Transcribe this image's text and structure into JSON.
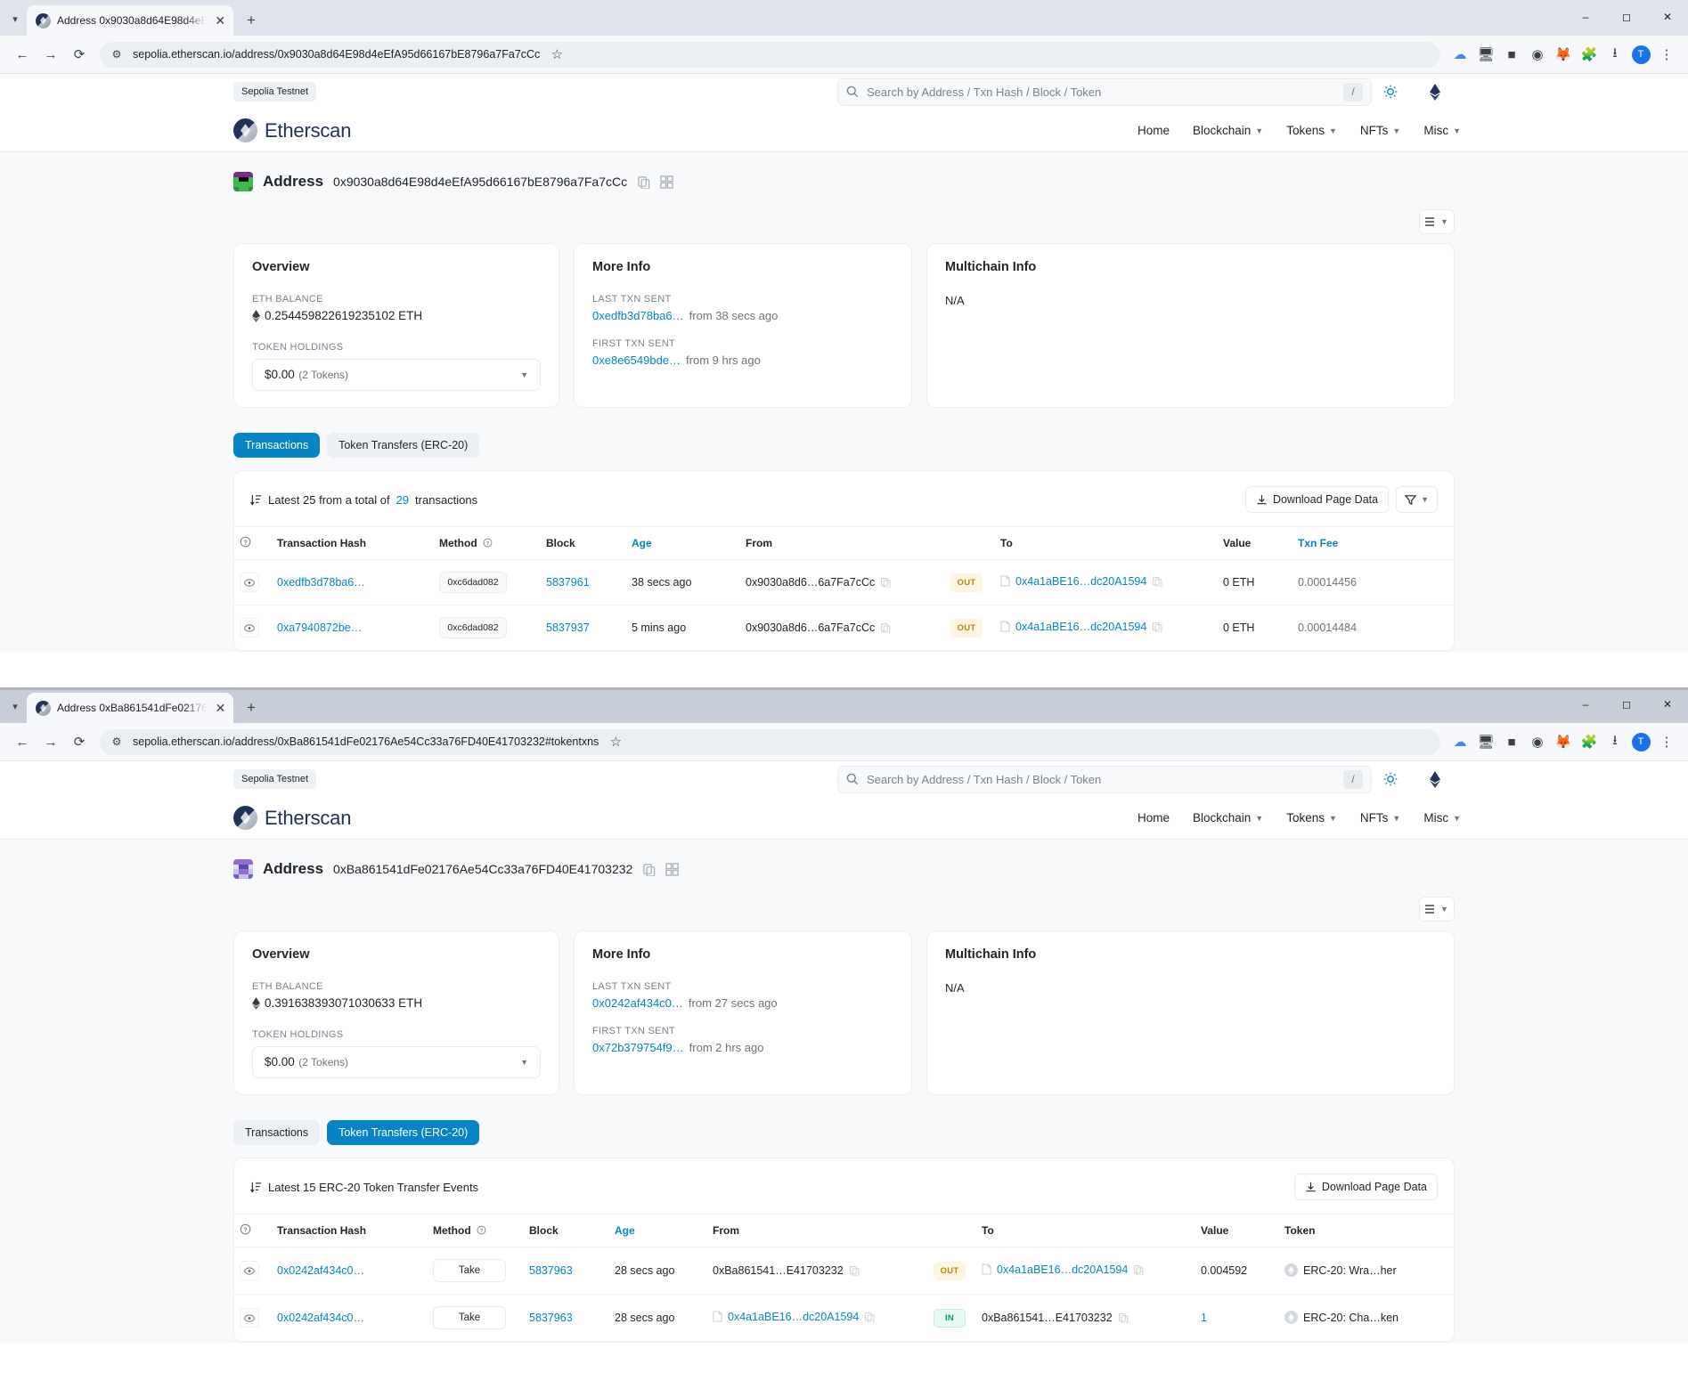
{
  "windows": [
    {
      "tab_title": "Address 0x9030a8d64E98d4eEf",
      "url": "sepolia.etherscan.io/address/0x9030a8d64E98d4eEfA95d66167bE8796a7Fa7cCc",
      "testnet_badge": "Sepolia Testnet",
      "search_placeholder": "Search by Address / Txn Hash / Block / Token",
      "search_key_hint": "/",
      "brand": "Etherscan",
      "nav": [
        "Home",
        "Blockchain",
        "Tokens",
        "NFTs",
        "Misc"
      ],
      "address_label": "Address",
      "address_hash": "0x9030a8d64E98d4eEfA95d66167bE8796a7Fa7cCc",
      "overview": {
        "title": "Overview",
        "eth_balance_label": "ETH BALANCE",
        "eth_balance_value": "0.254459822619235102 ETH",
        "token_holdings_label": "TOKEN HOLDINGS",
        "token_holdings_value": "$0.00",
        "token_holdings_count": "(2 Tokens)"
      },
      "more_info": {
        "title": "More Info",
        "last_txn_label": "LAST TXN SENT",
        "last_txn_hash": "0xedfb3d78ba6…",
        "last_txn_age": "from 38 secs ago",
        "first_txn_label": "FIRST TXN SENT",
        "first_txn_hash": "0xe8e6549bde…",
        "first_txn_age": "from 9 hrs ago"
      },
      "multichain": {
        "title": "Multichain Info",
        "value": "N/A"
      },
      "tabs": [
        {
          "label": "Transactions",
          "active": true
        },
        {
          "label": "Token Transfers (ERC-20)",
          "active": false
        }
      ],
      "panel": {
        "summary_prefix": "Latest 25 from a total of",
        "summary_count": "29",
        "summary_suffix": "transactions",
        "download_label": "Download Page Data"
      },
      "table": {
        "columns": [
          "",
          "Transaction Hash",
          "Method",
          "Block",
          "Age",
          "From",
          "",
          "To",
          "Value",
          "Txn Fee"
        ],
        "rows": [
          {
            "hash": "0xedfb3d78ba6…",
            "method": "0xc6dad082",
            "block": "5837961",
            "age": "38 secs ago",
            "from": "0x9030a8d6…6a7Fa7cCc",
            "dir": "OUT",
            "to": "0x4a1aBE16…dc20A1594",
            "value": "0 ETH",
            "fee": "0.00014456"
          },
          {
            "hash": "0xa7940872be…",
            "method": "0xc6dad082",
            "block": "5837937",
            "age": "5 mins ago",
            "from": "0x9030a8d6…6a7Fa7cCc",
            "dir": "OUT",
            "to": "0x4a1aBE16…dc20A1594",
            "value": "0 ETH",
            "fee": "0.00014484"
          }
        ]
      }
    },
    {
      "tab_title": "Address 0xBa861541dFe02176A",
      "url": "sepolia.etherscan.io/address/0xBa861541dFe02176Ae54Cc33a76FD40E41703232#tokentxns",
      "testnet_badge": "Sepolia Testnet",
      "search_placeholder": "Search by Address / Txn Hash / Block / Token",
      "search_key_hint": "/",
      "brand": "Etherscan",
      "nav": [
        "Home",
        "Blockchain",
        "Tokens",
        "NFTs",
        "Misc"
      ],
      "address_label": "Address",
      "address_hash": "0xBa861541dFe02176Ae54Cc33a76FD40E41703232",
      "overview": {
        "title": "Overview",
        "eth_balance_label": "ETH BALANCE",
        "eth_balance_value": "0.391638393071030633 ETH",
        "token_holdings_label": "TOKEN HOLDINGS",
        "token_holdings_value": "$0.00",
        "token_holdings_count": "(2 Tokens)"
      },
      "more_info": {
        "title": "More Info",
        "last_txn_label": "LAST TXN SENT",
        "last_txn_hash": "0x0242af434c0…",
        "last_txn_age": "from 27 secs ago",
        "first_txn_label": "FIRST TXN SENT",
        "first_txn_hash": "0x72b379754f9…",
        "first_txn_age": "from 2 hrs ago"
      },
      "multichain": {
        "title": "Multichain Info",
        "value": "N/A"
      },
      "tabs": [
        {
          "label": "Transactions",
          "active": false
        },
        {
          "label": "Token Transfers (ERC-20)",
          "active": true
        }
      ],
      "panel": {
        "summary_prefix": "Latest 15 ERC-20 Token Transfer Events",
        "summary_count": "",
        "summary_suffix": "",
        "download_label": "Download Page Data"
      },
      "table": {
        "columns": [
          "",
          "Transaction Hash",
          "Method",
          "Block",
          "Age",
          "From",
          "",
          "To",
          "Value",
          "Token"
        ],
        "rows": [
          {
            "hash": "0x0242af434c0…",
            "method": "Take",
            "block": "5837963",
            "age": "28 secs ago",
            "from": "0xBa861541…E41703232",
            "from_has_icon": false,
            "dir": "OUT",
            "to": "0x4a1aBE16…dc20A1594",
            "to_has_icon": true,
            "value": "0.004592",
            "token": "ERC-20: Wra…her"
          },
          {
            "hash": "0x0242af434c0…",
            "method": "Take",
            "block": "5837963",
            "age": "28 secs ago",
            "from": "0x4a1aBE16…dc20A1594",
            "from_has_icon": true,
            "dir": "IN",
            "to": "0xBa861541…E41703232",
            "to_has_icon": false,
            "value": "1",
            "token": "ERC-20: Cha…ken"
          }
        ]
      }
    }
  ],
  "colors": {
    "accent": "#0784c3",
    "brand": "#21325b",
    "out_badge": "#fdf5e2",
    "in_badge": "#e5f8f2"
  }
}
